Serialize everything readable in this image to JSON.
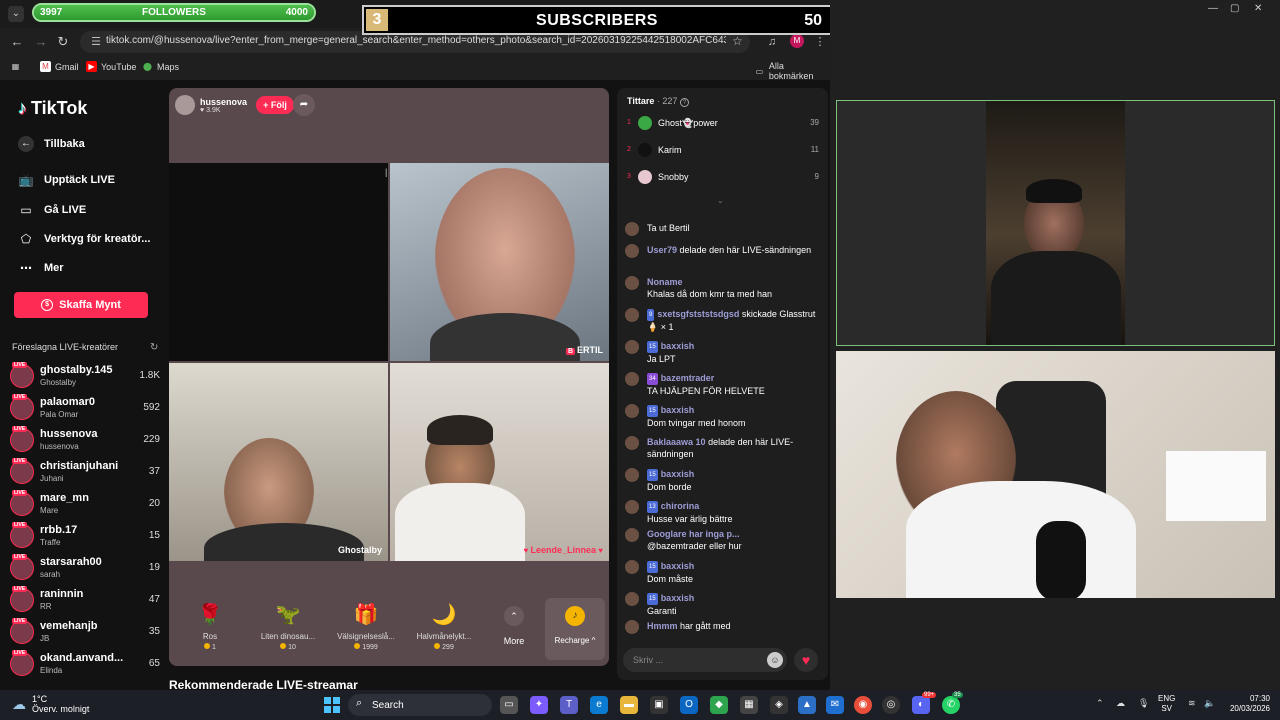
{
  "overlay": {
    "followers": {
      "current": "3997",
      "label": "FOLLOWERS",
      "goal": "4000",
      "progress": 0.999
    },
    "subscribers": {
      "number": "3",
      "label": "SUBSCRIBERS",
      "goal": "50"
    }
  },
  "browser": {
    "url": "tiktok.com/@hussenova/live?enter_from_merge=general_search&enter_method=others_photo&search_id=20260319225442518002AFC643CC8EC0E...",
    "bookmarks": [
      "Gmail",
      "YouTube",
      "Maps"
    ],
    "all_bookmarks": "Alla bokmärken",
    "profile_initial": "M"
  },
  "sidebar": {
    "logo": "TikTok",
    "back": "Tillbaka",
    "items": [
      "Upptäck LIVE",
      "Gå LIVE",
      "Verktyg för kreatör...",
      "Mer"
    ],
    "coins_button": "Skaffa Mynt",
    "suggested_title": "Föreslagna LIVE-kreatörer",
    "live_badge": "LIVE",
    "creators": [
      {
        "name": "ghostalby.145",
        "sub": "Ghostalby",
        "count": "1.8K"
      },
      {
        "name": "palaomar0",
        "sub": "Pala Omar",
        "count": "592"
      },
      {
        "name": "hussenova",
        "sub": "hussenova",
        "count": "229"
      },
      {
        "name": "christianjuhani",
        "sub": "Juhani",
        "count": "37"
      },
      {
        "name": "mare_mn",
        "sub": "Mare",
        "count": "20"
      },
      {
        "name": "rrbb.17",
        "sub": "Traffe",
        "count": "15"
      },
      {
        "name": "starsarah00",
        "sub": "sarah",
        "count": "19"
      },
      {
        "name": "raninnin",
        "sub": "RR",
        "count": "47"
      },
      {
        "name": "vemehanjb",
        "sub": "JB",
        "count": "35"
      },
      {
        "name": "okand.anvand...",
        "sub": "Elinda",
        "count": "65"
      }
    ]
  },
  "stream": {
    "host": "hussenova",
    "likes": "♥ 3.9K",
    "follow": "+ Följ",
    "cells": [
      {
        "name": ""
      },
      {
        "name": "ERTIL"
      },
      {
        "name": "Ghostalby"
      },
      {
        "name": "Leende_Linnea"
      }
    ],
    "gifts": [
      {
        "name": "Ros",
        "price": "1"
      },
      {
        "name": "Liten dinosau...",
        "price": "10"
      },
      {
        "name": "Välsignelseslå...",
        "price": "1999"
      },
      {
        "name": "Halvmånelykt...",
        "price": "299"
      }
    ],
    "more": "More",
    "recharge": "Recharge ^"
  },
  "recommended_title": "Rekommenderade LIVE-streamar",
  "chat": {
    "viewers_label": "Tittare",
    "viewers_count": "· 227",
    "top_viewers": [
      {
        "rank": "1",
        "name": "Ghost👻power",
        "score": "39",
        "color": "#3aa845"
      },
      {
        "rank": "2",
        "name": "Karim",
        "score": "11",
        "color": "#111111"
      },
      {
        "rank": "3",
        "name": "Snobby",
        "score": "9",
        "color": "#e8c8d0"
      }
    ],
    "messages": [
      {
        "user": "",
        "badge": "",
        "text": "Ta ut Bertil"
      },
      {
        "user": "User79",
        "badge": "",
        "text": "delade den här LIVE-sändningen"
      },
      {
        "user": "Noname",
        "badge": "",
        "text": "Khalas då dom kmr ta med han"
      },
      {
        "user": "sxetsgfstststsdgsd",
        "badge": "9",
        "text": "skickade Glasstrut 🍦 × 1"
      },
      {
        "user": "baxxish",
        "badge": "15",
        "text": "Ja LPT"
      },
      {
        "user": "bazemtrader",
        "badge": "34",
        "text": "TA HJÄLPEN FÖR HELVETE"
      },
      {
        "user": "baxxish",
        "badge": "15",
        "text": "Dom tvingar med honom"
      },
      {
        "user": "Baklaaawa 10",
        "badge": "",
        "text": "delade den här LIVE-sändningen"
      },
      {
        "user": "baxxish",
        "badge": "15",
        "text": "Dom borde"
      },
      {
        "user": "chirorina",
        "badge": "13",
        "text": "Husse var ärlig bättre"
      },
      {
        "user": "Googlare har inga p...",
        "badge": "",
        "text": "@bazemtrader eller hur"
      },
      {
        "user": "baxxish",
        "badge": "15",
        "text": "Dom måste"
      },
      {
        "user": "baxxish",
        "badge": "15",
        "text": "Garanti"
      },
      {
        "user": "Hmmm",
        "badge": "",
        "text": "har gått med"
      }
    ],
    "input_placeholder": "Skriv ..."
  },
  "taskbar": {
    "temp": "1°C",
    "weather": "Överv. molnigt",
    "search": "Search",
    "lang_top": "ENG",
    "lang_bottom": "SV",
    "time": "07:30",
    "date": "20/03/2026",
    "badge_a": "99+",
    "badge_b": "35"
  }
}
